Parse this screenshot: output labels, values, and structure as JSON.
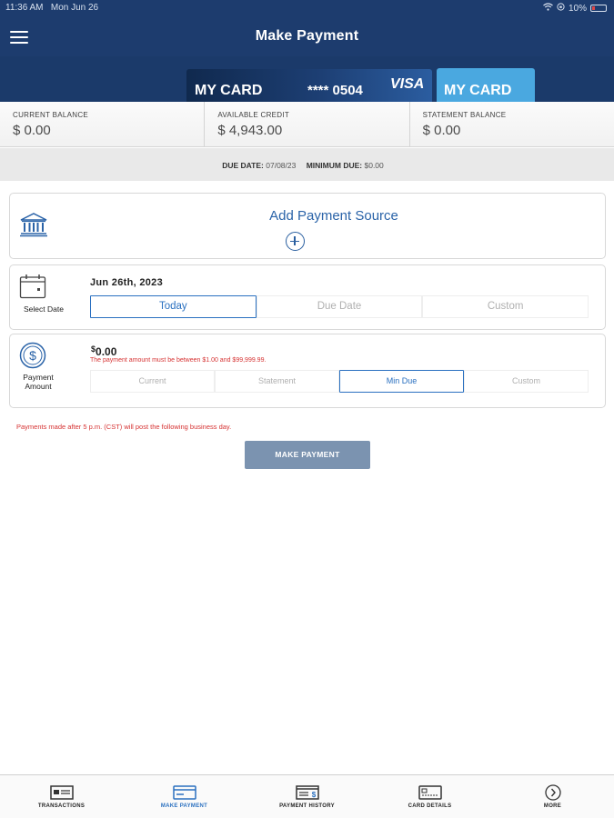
{
  "status_bar": {
    "time": "11:36 AM",
    "date": "Mon Jun 26",
    "battery": "10%"
  },
  "header": {
    "title": "Make Payment"
  },
  "cards": {
    "primary": {
      "name": "MY CARD",
      "number": "**** 0504",
      "brand": "VISA"
    },
    "secondary": {
      "name": "MY CARD"
    }
  },
  "balances": [
    {
      "label": "CURRENT BALANCE",
      "value": "$ 0.00"
    },
    {
      "label": "AVAILABLE CREDIT",
      "value": "$ 4,943.00"
    },
    {
      "label": "STATEMENT BALANCE",
      "value": "$ 0.00"
    }
  ],
  "due": {
    "due_label": "DUE DATE:",
    "due_value": "07/08/23",
    "min_label": "MINIMUM DUE:",
    "min_value": "$0.00"
  },
  "payment_source": {
    "label": "Add Payment Source"
  },
  "date_section": {
    "label": "Select Date",
    "value": "Jun 26th, 2023",
    "options": [
      "Today",
      "Due Date",
      "Custom"
    ],
    "selected": "Today"
  },
  "amount_section": {
    "label_line1": "Payment",
    "label_line2": "Amount",
    "currency": "$",
    "value": "0.00",
    "error": "The payment amount must be between $1.00 and $99,999.99.",
    "options": [
      "Current",
      "Statement",
      "Min Due",
      "Custom"
    ],
    "selected": "Min Due"
  },
  "notice": "Payments made after 5 p.m. (CST) will post the following business day.",
  "make_payment_button": "MAKE PAYMENT",
  "tabs": [
    {
      "label": "TRANSACTIONS",
      "icon": "transactions-icon",
      "active": false
    },
    {
      "label": "MAKE PAYMENT",
      "icon": "make-payment-icon",
      "active": true
    },
    {
      "label": "PAYMENT HISTORY",
      "icon": "payment-history-icon",
      "active": false
    },
    {
      "label": "CARD DETAILS",
      "icon": "card-details-icon",
      "active": false
    },
    {
      "label": "MORE",
      "icon": "chevron-right-circle-icon",
      "active": false
    }
  ],
  "colors": {
    "header": "#1d3c6e",
    "accent": "#2a70c0",
    "error": "#d63333",
    "button": "#7b93b0",
    "secondary_card": "#4aa8e0"
  }
}
